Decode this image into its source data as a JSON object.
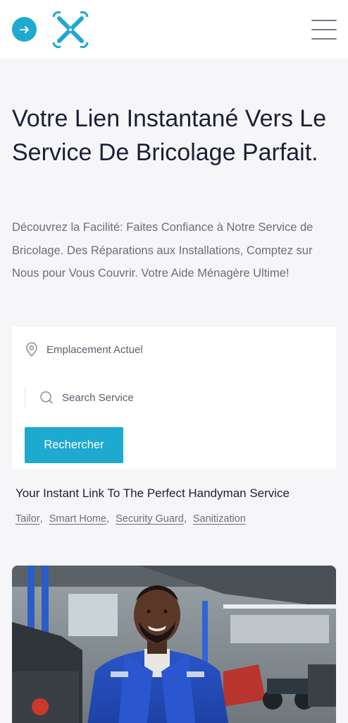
{
  "header": {
    "back_icon": "arrow-right-icon",
    "logo_icon": "crossed-wrenches-logo",
    "menu_icon": "hamburger-menu-icon",
    "accent_color": "#1ea9d0"
  },
  "hero": {
    "title": "Votre Lien Instantané Vers Le Service De Bricolage Parfait.",
    "description": "Découvrez la Facilité: Faites Confiance à Notre Service de Bricolage. Des Réparations aux Installations, Comptez sur Nous pour Vous Couvrir. Votre Aide Ménagère Ultime!"
  },
  "search": {
    "location_icon": "map-pin-icon",
    "location_label": "Emplacement Actuel",
    "service_icon": "search-icon",
    "service_placeholder": "Search Service",
    "button_label": "Rechercher"
  },
  "tagline": "Your Instant Link To The Perfect Handyman Service",
  "tags": [
    {
      "label": "Tailor",
      "sep": ","
    },
    {
      "label": "Smart Home",
      "sep": ","
    },
    {
      "label": "Security Guard",
      "sep": ","
    },
    {
      "label": "Sanitization",
      "sep": ""
    }
  ],
  "photo": {
    "subject": "smiling mechanic in blue overalls in a garage"
  }
}
